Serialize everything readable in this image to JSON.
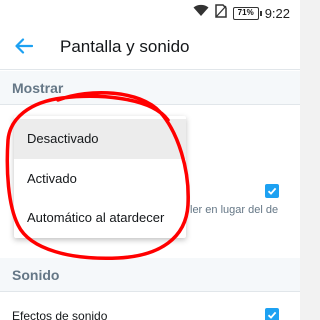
{
  "status_bar": {
    "battery_label": "71%",
    "time": "9:22",
    "icons": [
      "wifi-icon",
      "no-sim-icon",
      "battery-icon"
    ]
  },
  "app_bar": {
    "title": "Pantalla y sonido",
    "back_icon": "arrow-left-icon"
  },
  "sections": {
    "display_title": "Mostrar",
    "sound_title": "Sonido"
  },
  "hidden_row_text": "ler en lugar del de",
  "sound_effects_label": "Efectos de sonido",
  "dropdown": {
    "options": [
      "Desactivado",
      "Activado",
      "Automático al atardecer"
    ],
    "selected_index": 0
  },
  "colors": {
    "accent": "#1da1f2",
    "annotation": "#ff0000"
  }
}
